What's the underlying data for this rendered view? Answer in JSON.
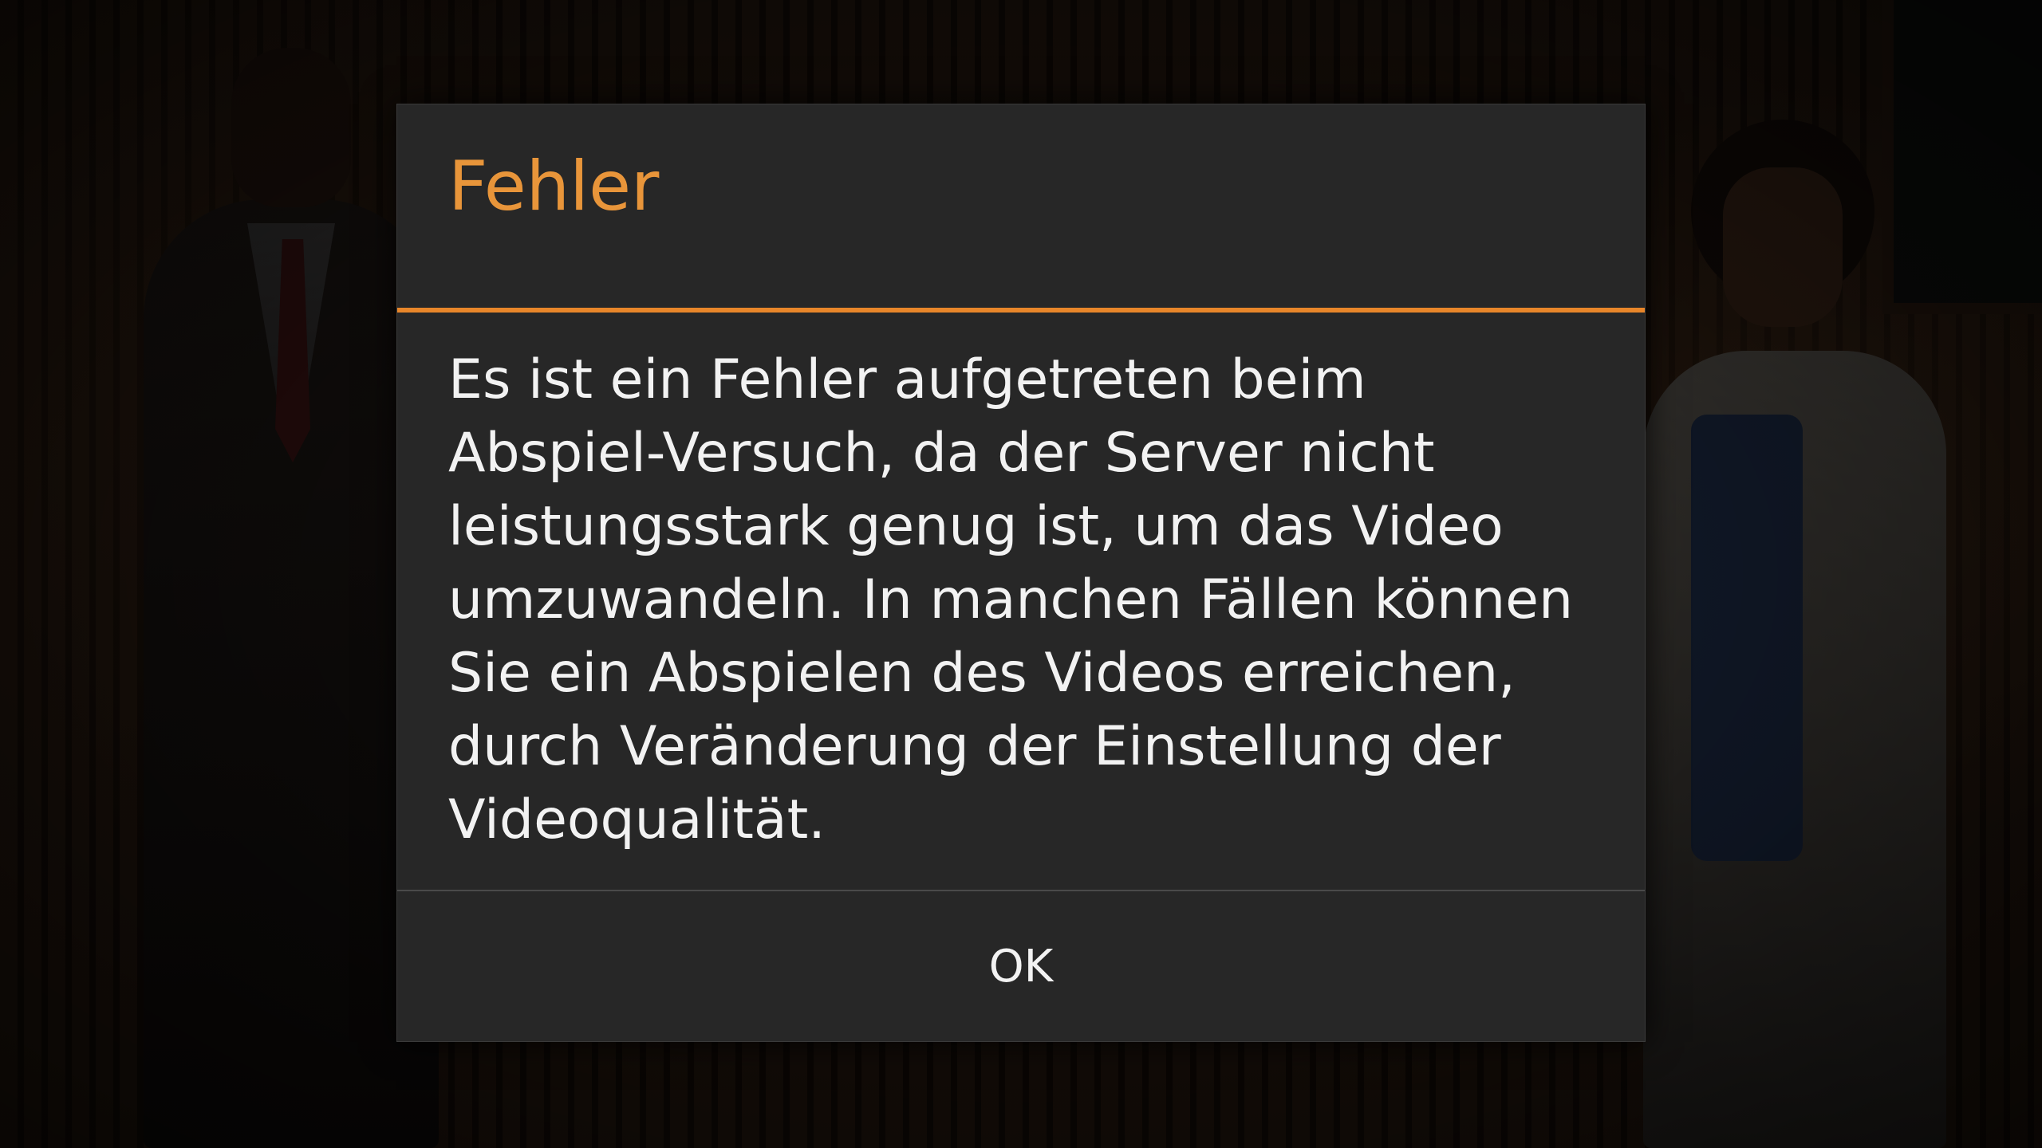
{
  "dialog": {
    "title": "Fehler",
    "message": "Es ist ein Fehler aufgetreten beim Abspiel-Versuch, da der Server nicht leistungsstark genug ist, um das Video umzuwandeln. In manchen Fällen können Sie ein Abspielen des Videos erreichen, durch Veränderung der Einstellung der Videoqualität.",
    "ok_label": "OK"
  },
  "colors": {
    "accent": "#e8862a",
    "title": "#e8953a",
    "dialog_background": "#272727",
    "text": "#f2f2f2"
  }
}
